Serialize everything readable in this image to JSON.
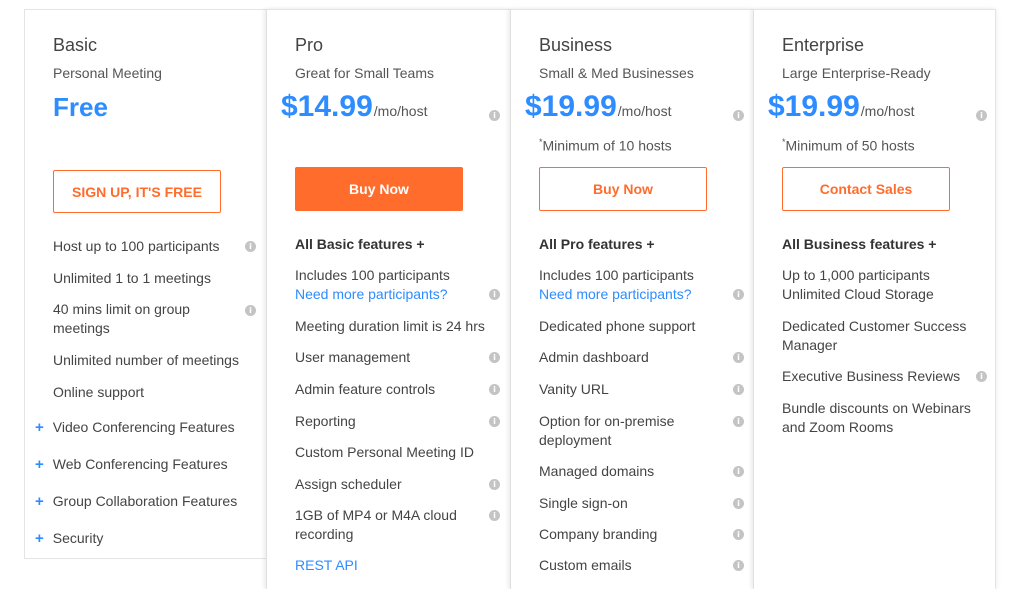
{
  "plans": {
    "basic": {
      "name": "Basic",
      "tagline": "Personal Meeting",
      "price_label": "Free",
      "button": "SIGN UP, IT'S FREE",
      "features": [
        "Host up to 100 participants",
        "Unlimited 1 to 1 meetings",
        "40 mins limit on group meetings",
        "Unlimited number of meetings",
        "Online support"
      ],
      "expanders": [
        "Video Conferencing Features",
        "Web Conferencing Features",
        "Group Collaboration Features",
        "Security"
      ]
    },
    "pro": {
      "name": "Pro",
      "tagline": "Great for Small Teams",
      "price": "$14.99",
      "unit": "/mo/host",
      "button": "Buy Now",
      "features_header": "All Basic features +",
      "features": [
        "Includes 100 participants",
        "Need more participants?",
        "Meeting duration limit is 24 hrs",
        "User management",
        "Admin feature controls",
        "Reporting",
        "Custom Personal Meeting ID",
        "Assign scheduler",
        "1GB of MP4 or M4A cloud recording",
        "REST API"
      ]
    },
    "business": {
      "name": "Business",
      "tagline": "Small & Med Businesses",
      "price": "$19.99",
      "unit": "/mo/host",
      "note": "Minimum of 10 hosts",
      "button": "Buy Now",
      "features_header": "All Pro features +",
      "features": [
        "Includes 100 participants",
        "Need more participants?",
        "Dedicated phone support",
        "Admin dashboard",
        "Vanity URL",
        "Option for on-premise deployment",
        "Managed domains",
        "Single sign-on",
        "Company branding",
        "Custom emails"
      ]
    },
    "enterprise": {
      "name": "Enterprise",
      "tagline": "Large Enterprise-Ready",
      "price": "$19.99",
      "unit": "/mo/host",
      "note": "Minimum of 50 hosts",
      "button": "Contact Sales",
      "features_header": "All Business features +",
      "features": [
        "Up to 1,000 participants",
        "Unlimited Cloud Storage",
        "Dedicated Customer Success Manager",
        "Executive Business Reviews",
        "Bundle discounts on Webinars and Zoom Rooms"
      ]
    }
  },
  "footnote_mark": "*",
  "info_glyph": "i",
  "plus_glyph": "+",
  "colors": {
    "accent": "#2d8cff",
    "cta": "#ff6c2c"
  }
}
